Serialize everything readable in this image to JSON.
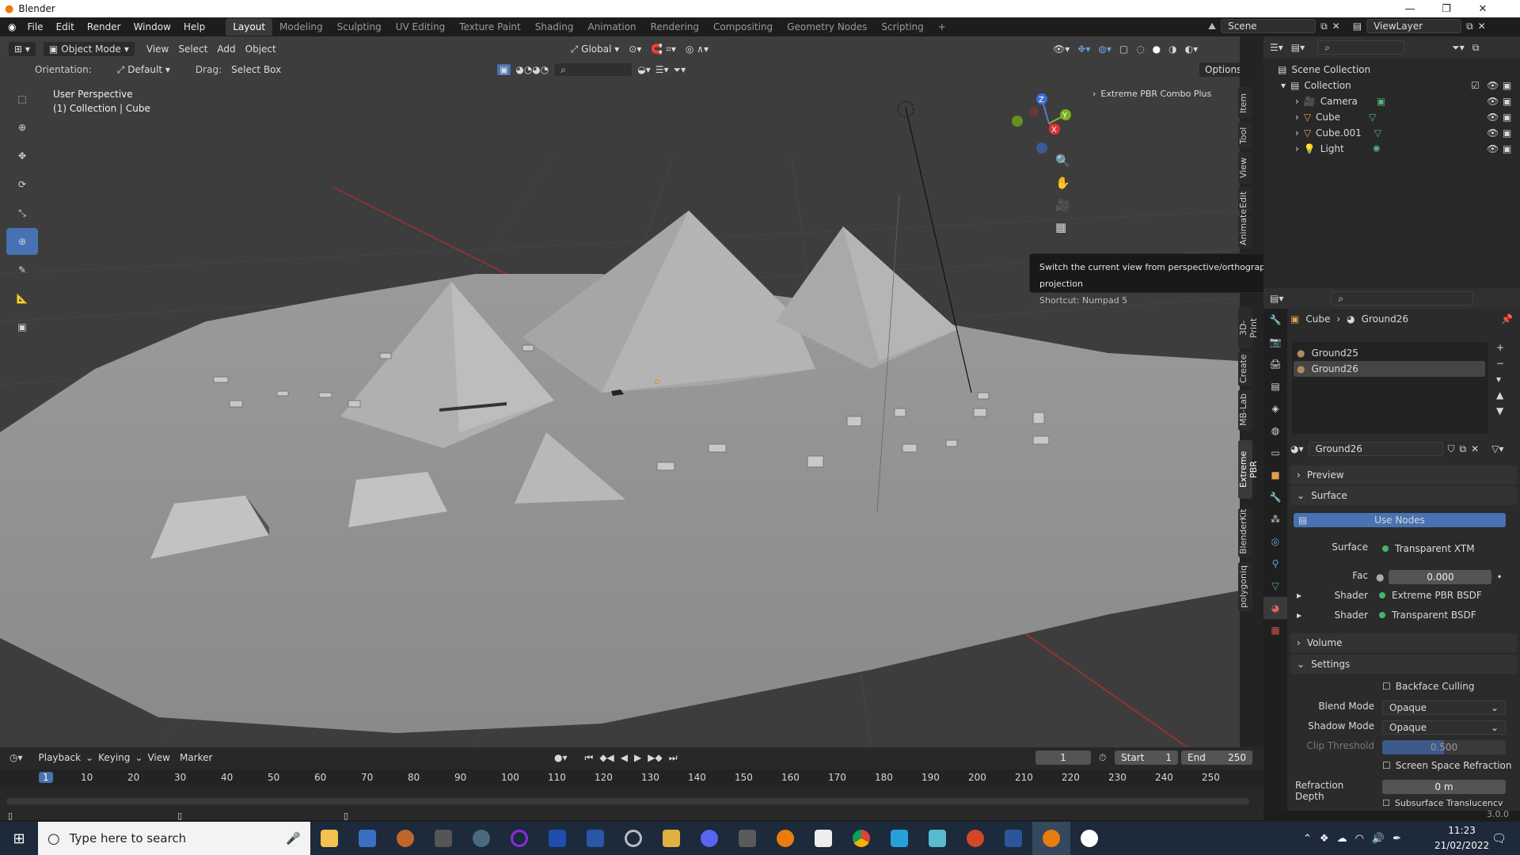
{
  "window": {
    "title": "Blender",
    "app_icon": "blender-icon"
  },
  "menu": [
    "File",
    "Edit",
    "Render",
    "Window",
    "Help"
  ],
  "workspaces": [
    "Layout",
    "Modeling",
    "Sculpting",
    "UV Editing",
    "Texture Paint",
    "Shading",
    "Animation",
    "Rendering",
    "Compositing",
    "Geometry Nodes",
    "Scripting"
  ],
  "active_workspace": "Layout",
  "scene": {
    "name": "Scene",
    "view_layer": "ViewLayer"
  },
  "viewport_header": {
    "mode": "Object Mode",
    "view": "View",
    "select": "Select",
    "add": "Add",
    "object": "Object",
    "transform_orientation": "Global"
  },
  "tool_header": {
    "orientation_label": "Orientation:",
    "orientation": "Default",
    "drag_label": "Drag:",
    "drag": "Select Box",
    "options": "Options"
  },
  "viewport_info": {
    "line1": "User Perspective",
    "line2": "(1) Collection | Cube"
  },
  "npanel_addon": "Extreme PBR Combo Plus",
  "side_tabs": [
    "Item",
    "Tool",
    "View",
    "Edit",
    "Animate",
    "3D-Print",
    "Create",
    "MB-Lab",
    "Extreme PBR",
    "BlenderKit",
    "polygoniq"
  ],
  "gizmo": {
    "z": "Z",
    "y": "Y",
    "x": "X"
  },
  "tooltip": {
    "title": "Switch the current view from perspective/orthographic projection",
    "shortcut": "Shortcut: Numpad 5"
  },
  "outliner": {
    "root": "Scene Collection",
    "collection": "Collection",
    "items": [
      {
        "name": "Camera",
        "icon": "camera-icon"
      },
      {
        "name": "Cube",
        "icon": "mesh-icon"
      },
      {
        "name": "Cube.001",
        "icon": "mesh-icon"
      },
      {
        "name": "Light",
        "icon": "light-icon"
      }
    ]
  },
  "properties": {
    "breadcrumb_object": "Cube",
    "breadcrumb_material": "Ground26",
    "slots": [
      "Ground25",
      "Ground26"
    ],
    "material_name": "Ground26",
    "panels": {
      "preview": "Preview",
      "surface": "Surface",
      "volume": "Volume",
      "settings": "Settings"
    },
    "use_nodes": "Use Nodes",
    "surface_label": "Surface",
    "surface_value": "Transparent XTM",
    "fac_label": "Fac",
    "fac_value": "0.000",
    "shader1_label": "Shader",
    "shader1_value": "Extreme PBR BSDF",
    "shader2_label": "Shader",
    "shader2_value": "Transparent BSDF",
    "backface_culling": "Backface Culling",
    "blend_mode_label": "Blend Mode",
    "blend_mode": "Opaque",
    "shadow_mode_label": "Shadow Mode",
    "shadow_mode": "Opaque",
    "clip_threshold_label": "Clip Threshold",
    "clip_threshold": "0.500",
    "screen_space_refraction": "Screen Space Refraction",
    "refraction_depth_label": "Refraction Depth",
    "refraction_depth": "0 m",
    "subsurface": "Subsurface Translucency",
    "version": "3.0.0"
  },
  "timeline": {
    "menus": [
      "Playback",
      "Keying",
      "View",
      "Marker"
    ],
    "current_frame": "1",
    "start_label": "Start",
    "start": "1",
    "end_label": "End",
    "end": "250",
    "ticks": [
      "1",
      "10",
      "20",
      "30",
      "40",
      "50",
      "60",
      "70",
      "80",
      "90",
      "100",
      "110",
      "120",
      "130",
      "140",
      "150",
      "160",
      "170",
      "180",
      "190",
      "200",
      "210",
      "220",
      "230",
      "240",
      "250"
    ]
  },
  "taskbar": {
    "search_placeholder": "Type here to search",
    "time": "11:23",
    "date": "21/02/2022"
  },
  "colors": {
    "accent": "#4772b3",
    "viewport_bg": "#3d3d3d",
    "axis_red": "#b03030",
    "axis_green": "#5a8a2a"
  }
}
